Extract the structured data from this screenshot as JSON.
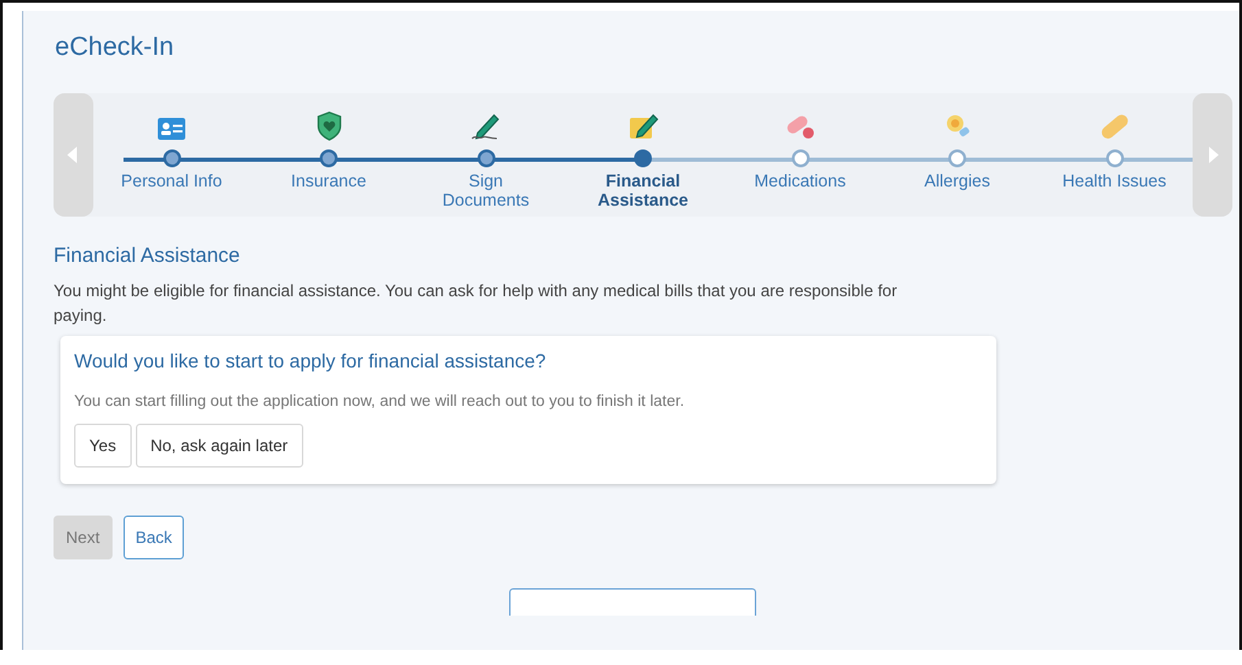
{
  "title": "eCheck-In",
  "steps": [
    {
      "label": "Personal Info",
      "completed": true,
      "selected": false
    },
    {
      "label": "Insurance",
      "completed": true,
      "selected": false
    },
    {
      "label": "Sign Documents",
      "completed": true,
      "selected": false
    },
    {
      "label": "Financial Assistance",
      "completed": false,
      "selected": true
    },
    {
      "label": "Medications",
      "completed": false,
      "selected": false
    },
    {
      "label": "Allergies",
      "completed": false,
      "selected": false
    },
    {
      "label": "Health Issues",
      "completed": false,
      "selected": false
    }
  ],
  "section": {
    "heading": "Financial Assistance",
    "text": "You might be eligible for financial assistance. You can ask for help with any medical bills that you are responsible for paying."
  },
  "card": {
    "question": "Would you like to start to apply for financial assistance?",
    "hint": "You can start filling out the application now, and we will reach out to you to finish it later.",
    "options": [
      "Yes",
      "No, ask again later"
    ]
  },
  "nav": [
    {
      "label": "Next",
      "disabled": true
    },
    {
      "label": "Back",
      "disabled": false
    }
  ]
}
